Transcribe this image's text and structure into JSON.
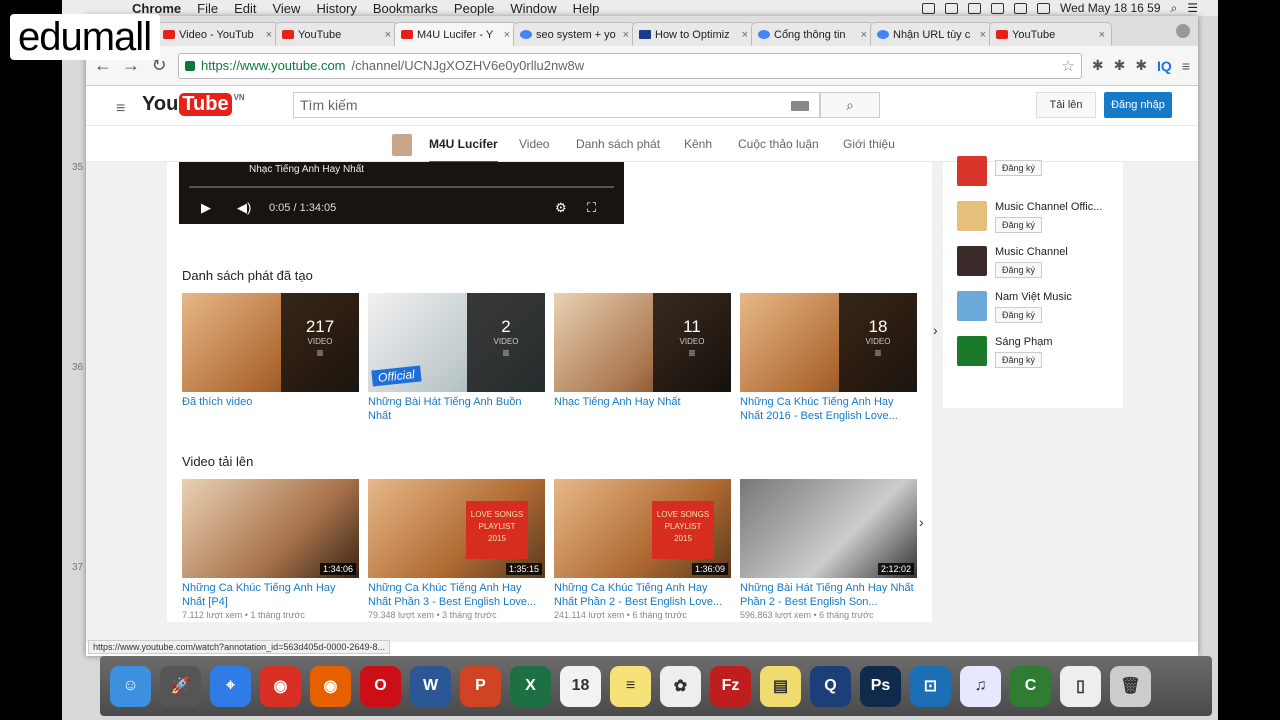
{
  "brand": {
    "logo_text": "edumall"
  },
  "menubar": {
    "app": "Chrome",
    "items": [
      "File",
      "Edit",
      "View",
      "History",
      "Bookmarks",
      "People",
      "Window",
      "Help"
    ],
    "datetime": "Wed May 18 16 59"
  },
  "tabs": [
    {
      "title": "Video - YouTub",
      "fav": "yt"
    },
    {
      "title": "YouTube",
      "fav": "yt"
    },
    {
      "title": "M4U Lucifer - Y",
      "fav": "yt",
      "active": true
    },
    {
      "title": "seo system + yo",
      "fav": "g"
    },
    {
      "title": "How to Optimiz",
      "fav": "m"
    },
    {
      "title": "Cổng thông tin",
      "fav": "g"
    },
    {
      "title": "Nhận URL tùy c",
      "fav": "g"
    },
    {
      "title": "YouTube",
      "fav": "yt"
    }
  ],
  "omnibox": {
    "url_host": "https://www.youtube.com",
    "url_path": "/channel/UCNJgXOZHV6e0y0rllu2nw8w"
  },
  "toolbar": {
    "ext_iq": "IQ"
  },
  "youtube": {
    "logo_you": "You",
    "logo_tube": "Tube",
    "country": "VN",
    "search_placeholder": "Tìm kiếm",
    "upload": "Tải lên",
    "signin": "Đăng nhập"
  },
  "channel": {
    "name": "M4U Lucifer",
    "tabs": [
      "Video",
      "Danh sách phát",
      "Kênh",
      "Cuộc thảo luận",
      "Giới thiệu"
    ]
  },
  "player": {
    "title": "Nhạc Tiếng Anh Hay Nhất",
    "time": "0:05 / 1:34:05"
  },
  "playlists": {
    "heading": "Danh sách phát đã tạo",
    "items": [
      {
        "title": "Đã thích video",
        "count": "217",
        "label": "VIDEO",
        "style": "warm"
      },
      {
        "title": "Những Bài Hát Tiếng Anh Buồn Nhất",
        "count": "2",
        "label": "VIDEO",
        "style": "white",
        "badge": "Official"
      },
      {
        "title": "Nhạc Tiếng Anh Hay Nhất",
        "count": "11",
        "label": "VIDEO",
        "style": "dusk"
      },
      {
        "title": "Những Ca Khúc Tiếng Anh Hay Nhất 2016 - Best English Love...",
        "count": "18",
        "label": "VIDEO",
        "style": "warm"
      }
    ]
  },
  "uploads": {
    "heading": "Video tải lên",
    "items": [
      {
        "title": "Những Ca Khúc Tiếng Anh Hay Nhất [P4]",
        "duration": "1:34:06",
        "views": "7.112 lượt xem",
        "age": "1 tháng trước",
        "style": "dusk"
      },
      {
        "title": "Những Ca Khúc Tiếng Anh Hay Nhất Phần 3 - Best English Love...",
        "duration": "1:35:15",
        "views": "79.348 lượt xem",
        "age": "3 tháng trước",
        "style": "warm",
        "ribbon": [
          "LOVE SONGS",
          "PLAYLIST",
          "2015"
        ]
      },
      {
        "title": "Những Ca Khúc Tiếng Anh Hay Nhất Phần 2 - Best English Love...",
        "duration": "1:36:09",
        "views": "241.114 lượt xem",
        "age": "6 tháng trước",
        "style": "warm",
        "ribbon": [
          "LOVE SONGS",
          "PLAYLIST",
          "2015"
        ]
      },
      {
        "title": "Những Bài Hát Tiếng Anh Hay Nhất Phần 2 - Best English Son...",
        "duration": "2:12:02",
        "views": "596.863 lượt xem",
        "age": "6 tháng trước",
        "style": "gray"
      }
    ]
  },
  "sidebar": {
    "subscribe_label": "Đăng ký",
    "channels": [
      {
        "name": "",
        "color": "#d9352b"
      },
      {
        "name": "Music Channel Offic...",
        "color": "#e5c07b"
      },
      {
        "name": "Music Channel",
        "color": "#3a2a2a"
      },
      {
        "name": "Nam Việt Music",
        "color": "#6aa9d8"
      },
      {
        "name": "Sáng Phạm",
        "color": "#1a7a2a"
      }
    ]
  },
  "status_url": "https://www.youtube.com/watch?annotation_id=563d405d-0000-2649-8...",
  "line_numbers": [
    "35",
    "36",
    "37"
  ],
  "dock": [
    {
      "name": "finder-icon",
      "color": "#3d8fe0",
      "glyph": "☺"
    },
    {
      "name": "launchpad-icon",
      "color": "#555",
      "glyph": "🚀"
    },
    {
      "name": "safari-icon",
      "color": "#2f7ce6",
      "glyph": "⌖"
    },
    {
      "name": "chrome-icon",
      "color": "#d93025",
      "glyph": "◉"
    },
    {
      "name": "firefox-icon",
      "color": "#e66000",
      "glyph": "◉"
    },
    {
      "name": "opera-icon",
      "color": "#cc0f16",
      "glyph": "O"
    },
    {
      "name": "word-icon",
      "color": "#2b5797",
      "glyph": "W"
    },
    {
      "name": "powerpoint-icon",
      "color": "#d04423",
      "glyph": "P"
    },
    {
      "name": "excel-icon",
      "color": "#1d7044",
      "glyph": "X"
    },
    {
      "name": "calendar-icon",
      "color": "#f2f2f2",
      "glyph": "18"
    },
    {
      "name": "notes-icon",
      "color": "#f7e27a",
      "glyph": "≡"
    },
    {
      "name": "photos-icon",
      "color": "#eee",
      "glyph": "✿"
    },
    {
      "name": "filezilla-icon",
      "color": "#bf1e1e",
      "glyph": "Fz"
    },
    {
      "name": "stickies-icon",
      "color": "#f0dc6e",
      "glyph": "▤"
    },
    {
      "name": "quicktime-icon",
      "color": "#1c3f7a",
      "glyph": "Q"
    },
    {
      "name": "photoshop-icon",
      "color": "#0f2a4a",
      "glyph": "Ps"
    },
    {
      "name": "window-app-icon",
      "color": "#1c6fb5",
      "glyph": "⊡"
    },
    {
      "name": "itunes-icon",
      "color": "#e7e7ff",
      "glyph": "♫"
    },
    {
      "name": "camtasia-icon",
      "color": "#2e7d32",
      "glyph": "C"
    },
    {
      "name": "document-icon",
      "color": "#eee",
      "glyph": "▯"
    },
    {
      "name": "trash-icon",
      "color": "#ccc",
      "glyph": "🗑"
    }
  ]
}
